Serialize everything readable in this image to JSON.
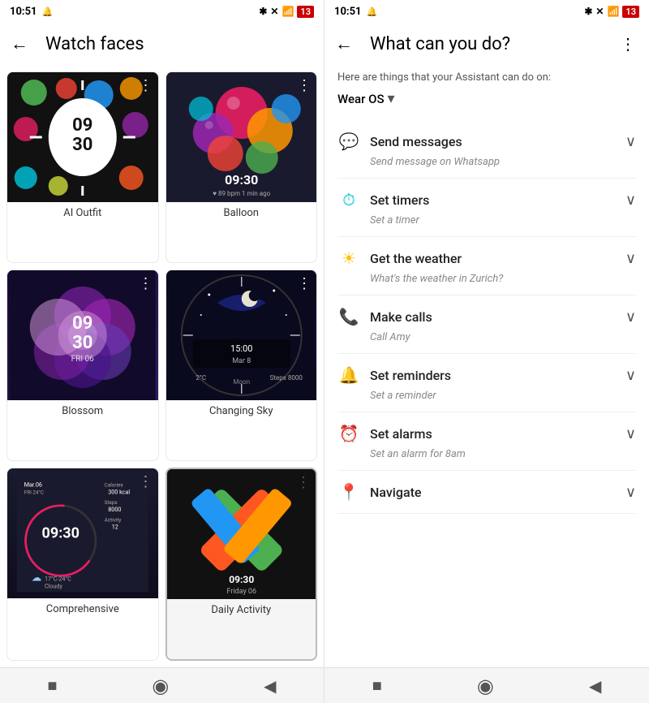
{
  "left": {
    "status_bar": {
      "time": "10:51",
      "icons": [
        "📶",
        "🔋"
      ]
    },
    "title": "Watch faces",
    "cards": [
      {
        "id": "ai-outfit",
        "label": "AI Outfit"
      },
      {
        "id": "balloon",
        "label": "Balloon"
      },
      {
        "id": "blossom",
        "label": "Blossom"
      },
      {
        "id": "changing-sky",
        "label": "Changing Sky"
      },
      {
        "id": "comprehensive",
        "label": "Comprehensive"
      },
      {
        "id": "daily-activity",
        "label": "Daily Activity"
      }
    ],
    "nav": {
      "square": "■",
      "circle": "⬤",
      "back": "◀"
    }
  },
  "right": {
    "status_bar": {
      "time": "10:51"
    },
    "title": "What can you do?",
    "subtitle": "Here are things that your Assistant can do on:",
    "platform": "Wear OS",
    "features": [
      {
        "id": "send-messages",
        "icon": "💬",
        "icon_color": "#4CAF50",
        "title": "Send messages",
        "subtitle": "Send message on Whatsapp"
      },
      {
        "id": "set-timers",
        "icon": "⏱",
        "icon_color": "#00BCD4",
        "title": "Set timers",
        "subtitle": "Set a timer"
      },
      {
        "id": "get-weather",
        "icon": "☀",
        "icon_color": "#FFC107",
        "title": "Get the weather",
        "subtitle": "What's the weather in Zurich?"
      },
      {
        "id": "make-calls",
        "icon": "📞",
        "icon_color": "#2196F3",
        "title": "Make calls",
        "subtitle": "Call Amy"
      },
      {
        "id": "set-reminders",
        "icon": "🔔",
        "icon_color": "#00BCD4",
        "title": "Set reminders",
        "subtitle": "Set a reminder"
      },
      {
        "id": "set-alarms",
        "icon": "⏰",
        "icon_color": "#00BCD4",
        "title": "Set alarms",
        "subtitle": "Set an alarm for 8am"
      },
      {
        "id": "navigate",
        "icon": "📍",
        "icon_color": "#4CAF50",
        "title": "Navigate",
        "subtitle": ""
      }
    ],
    "nav": {
      "square": "■",
      "circle": "⬤",
      "back": "◀"
    }
  }
}
